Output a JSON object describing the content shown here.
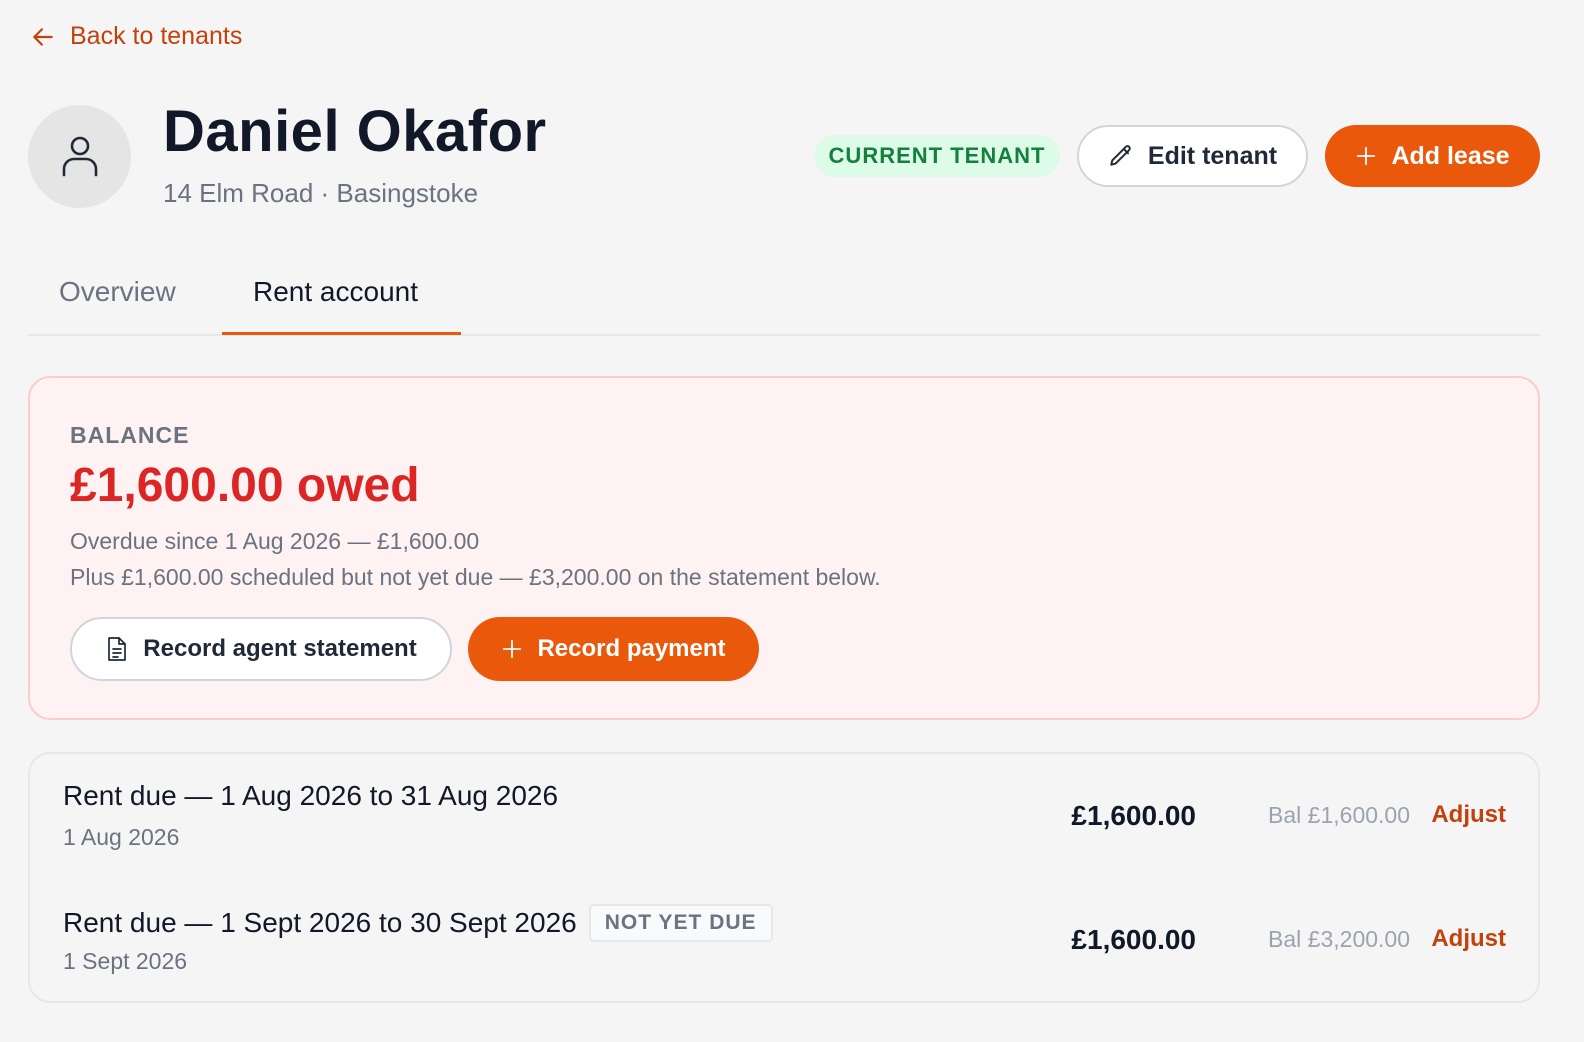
{
  "nav": {
    "back_label": "Back to tenants"
  },
  "tenant": {
    "name": "Daniel Okafor",
    "address": "14 Elm Road · Basingstoke",
    "status_badge": "CURRENT TENANT"
  },
  "actions": {
    "edit_label": "Edit tenant",
    "add_lease_label": "Add lease"
  },
  "tabs": [
    {
      "label": "Overview",
      "active": false
    },
    {
      "label": "Rent account",
      "active": true
    }
  ],
  "balance": {
    "label": "BALANCE",
    "amount": "£1,600.00 owed",
    "overdue_line": "Overdue since 1 Aug 2026 — £1,600.00",
    "scheduled_line": "Plus £1,600.00 scheduled but not yet due — £3,200.00 on the statement below.",
    "record_statement_label": "Record agent statement",
    "record_payment_label": "Record payment"
  },
  "statement": [
    {
      "title": "Rent due — 1 Aug 2026 to 31 Aug 2026",
      "date": "1 Aug 2026",
      "tag": "",
      "amount": "£1,600.00",
      "balance": "Bal £1,600.00",
      "action": "Adjust"
    },
    {
      "title": "Rent due — 1 Sept 2026 to 30 Sept 2026",
      "date": "1 Sept 2026",
      "tag": "NOT YET DUE",
      "amount": "£1,600.00",
      "balance": "Bal £3,200.00",
      "action": "Adjust"
    }
  ],
  "colors": {
    "accent": "#ea580c",
    "link": "#c2410c",
    "owed": "#dc2626",
    "badge_bg": "#dcfce7",
    "badge_text": "#15803d"
  },
  "icons": {
    "back": "arrow-left-icon",
    "avatar": "user-icon",
    "edit": "pencil-icon",
    "add": "plus-icon",
    "statement": "document-icon"
  }
}
